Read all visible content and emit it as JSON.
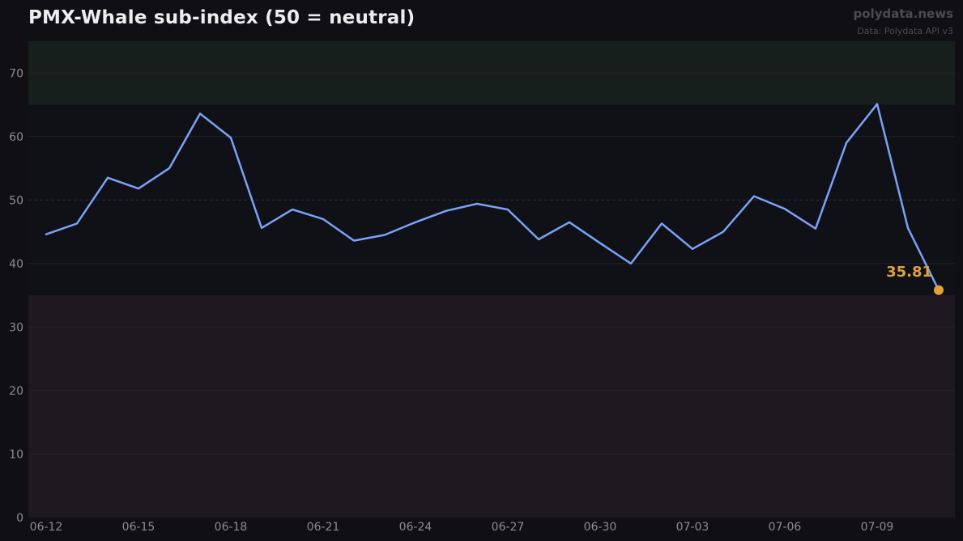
{
  "chart_data": {
    "type": "line",
    "title": "PMX-Whale sub-index (50 = neutral)",
    "watermark": "polydata.news",
    "source": "Data: Polydata API v3",
    "xlabel": "",
    "ylabel": "",
    "ylim": [
      0,
      75
    ],
    "yticks": [
      0,
      10,
      20,
      30,
      40,
      50,
      60,
      70
    ],
    "x_tick_labels": [
      "06-12",
      "06-15",
      "06-18",
      "06-21",
      "06-24",
      "06-27",
      "06-30",
      "07-03",
      "07-06",
      "07-09"
    ],
    "x": [
      "06-12",
      "06-13",
      "06-14",
      "06-15",
      "06-16",
      "06-17",
      "06-18",
      "06-19",
      "06-20",
      "06-21",
      "06-22",
      "06-23",
      "06-24",
      "06-25",
      "06-26",
      "06-27",
      "06-28",
      "06-29",
      "06-30",
      "07-01",
      "07-02",
      "07-03",
      "07-04",
      "07-05",
      "07-06",
      "07-07",
      "07-08",
      "07-09",
      "07-10",
      "07-11"
    ],
    "series": [
      {
        "color": "#7aa2f7",
        "values": [
          44.6,
          46.3,
          53.5,
          51.8,
          55.0,
          63.6,
          59.8,
          45.6,
          48.5,
          47.0,
          43.6,
          44.5,
          46.5,
          48.3,
          49.4,
          48.5,
          43.8,
          46.5,
          43.2,
          40.0,
          46.3,
          42.3,
          45.0,
          50.6,
          48.6,
          45.5,
          59.0,
          65.1,
          45.6,
          35.81
        ]
      }
    ],
    "bands": [
      {
        "from": 65,
        "to": 75,
        "color": "#161f1c"
      },
      {
        "from": 0,
        "to": 35,
        "color": "#201820"
      }
    ],
    "reference_line": 50,
    "last_value_label": "35.81",
    "last_point_color": "#e0a33a",
    "grid": true
  }
}
